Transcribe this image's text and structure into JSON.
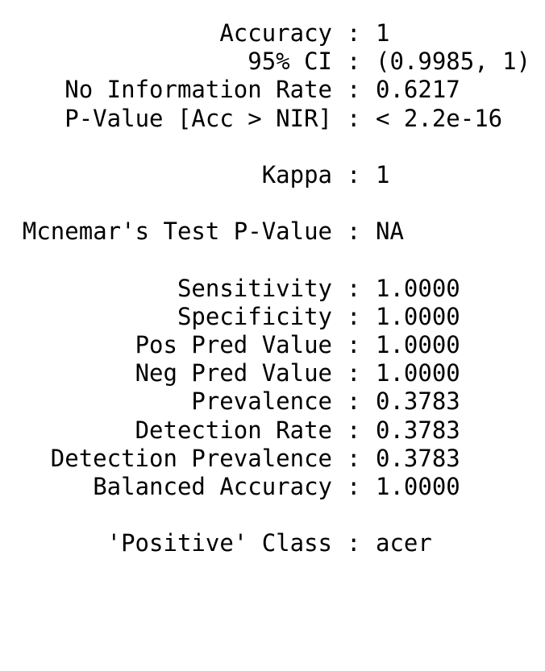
{
  "stats": {
    "separator": ":",
    "groups": [
      [
        {
          "label": "Accuracy",
          "value": "1"
        },
        {
          "label": "95% CI",
          "value": "(0.9985, 1)"
        },
        {
          "label": "No Information Rate",
          "value": "0.6217"
        },
        {
          "label": "P-Value [Acc > NIR]",
          "value": "< 2.2e-16"
        }
      ],
      [
        {
          "label": "Kappa",
          "value": "1"
        }
      ],
      [
        {
          "label": "Mcnemar's Test P-Value",
          "value": "NA"
        }
      ],
      [
        {
          "label": "Sensitivity",
          "value": "1.0000"
        },
        {
          "label": "Specificity",
          "value": "1.0000"
        },
        {
          "label": "Pos Pred Value",
          "value": "1.0000"
        },
        {
          "label": "Neg Pred Value",
          "value": "1.0000"
        },
        {
          "label": "Prevalence",
          "value": "0.3783"
        },
        {
          "label": "Detection Rate",
          "value": "0.3783"
        },
        {
          "label": "Detection Prevalence",
          "value": "0.3783"
        },
        {
          "label": "Balanced Accuracy",
          "value": "1.0000"
        }
      ],
      [
        {
          "label": "'Positive' Class",
          "value": "acer"
        }
      ]
    ]
  }
}
